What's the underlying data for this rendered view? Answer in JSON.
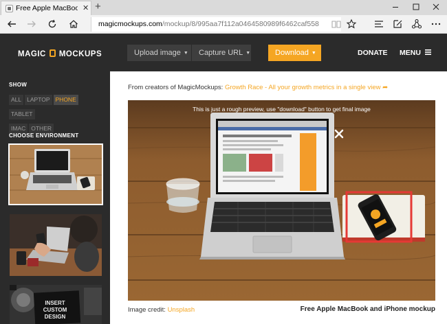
{
  "browser": {
    "tab_title": "Free Apple MacBook an",
    "tab_close": "✕",
    "new_tab": "+",
    "address_host": "magicmockups.com",
    "address_path": "/mockup/8/995aa7f112a0464580989f6462caf558",
    "icons": [
      "back-icon",
      "forward-icon",
      "refresh-icon",
      "home-icon",
      "reading-view-icon",
      "favorite-star-icon",
      "hub-icon",
      "web-note-icon",
      "share-icon",
      "minimize-icon",
      "maximize-icon",
      "close-icon"
    ]
  },
  "header": {
    "logo_left": "MAGIC",
    "logo_right": "MOCKUPS",
    "upload_label": "Upload image",
    "capture_label": "Capture URL",
    "download_label": "Download",
    "donate_label": "DONATE",
    "menu_label": "MENU"
  },
  "sidebar": {
    "show_heading": "SHOW",
    "filters": [
      "ALL",
      "LAPTOP",
      "PHONE",
      "TABLET",
      "IMAC",
      "OTHER"
    ],
    "active_filter": "PHONE",
    "env_heading": "CHOOSE ENVIRONMENT",
    "thumbnail3_text": [
      "INSERT",
      "CUSTOM",
      "DESIGN"
    ]
  },
  "main": {
    "creators_prefix": "From creators of MagicMockups:",
    "creators_link": "Growth Race - All your growth metrics in a single view",
    "preview_note": "This is just a rough preview, use \"download\" button to get final image",
    "credit_prefix": "Image credit:",
    "credit_link": "Unsplash",
    "caption": "Free Apple MacBook and iPhone mockup"
  },
  "colors": {
    "accent": "#f5a623",
    "dark_bg": "#2b2b2b",
    "selection_box": "#e53935"
  }
}
